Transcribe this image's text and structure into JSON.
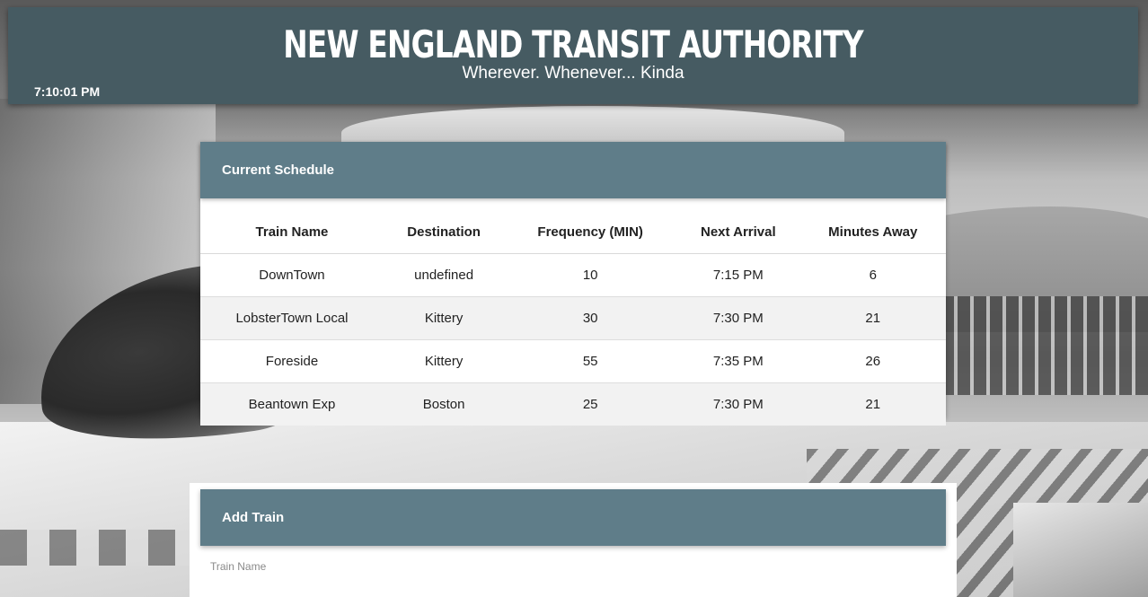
{
  "header": {
    "title": "NEW ENGLAND TRANSIT AUTHORITY",
    "tagline": "Wherever. Whenever... Kinda",
    "clock": "7:10:01 PM"
  },
  "schedule": {
    "heading": "Current Schedule",
    "columns": [
      "Train Name",
      "Destination",
      "Frequency (MIN)",
      "Next Arrival",
      "Minutes Away"
    ],
    "rows": [
      [
        "DownTown",
        "undefined",
        "10",
        "7:15 PM",
        "6"
      ],
      [
        "LobsterTown Local",
        "Kittery",
        "30",
        "7:30 PM",
        "21"
      ],
      [
        "Foreside",
        "Kittery",
        "55",
        "7:35 PM",
        "26"
      ],
      [
        "Beantown Exp",
        "Boston",
        "25",
        "7:30 PM",
        "21"
      ]
    ]
  },
  "add_train": {
    "heading": "Add Train",
    "fields": {
      "train_name_label": "Train Name"
    }
  },
  "colors": {
    "header_bg": "#465b62",
    "card_head_bg": "#5f7d89"
  }
}
